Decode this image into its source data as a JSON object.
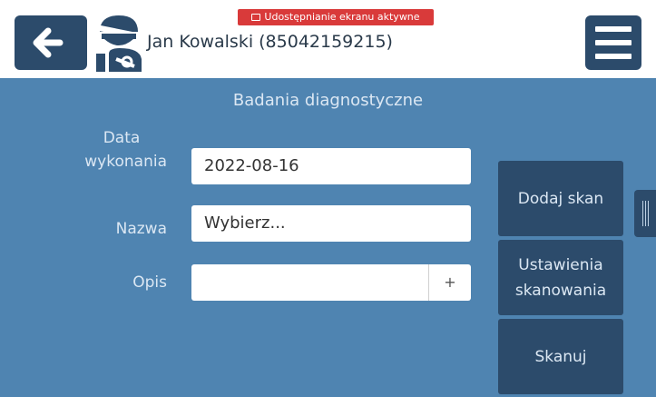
{
  "header": {
    "patient_name": "Jan Kowalski (85042159215)",
    "share_banner": "Udostępnianie ekranu aktywne",
    "back_icon": "arrow-left-icon",
    "menu_icon": "hamburger-menu-icon",
    "patient_icon": "injured-patient-icon"
  },
  "form": {
    "title": "Badania diagnostyczne",
    "date_label_line1": "Data",
    "date_label_line2": "wykonania",
    "date_value": "2022-08-16",
    "name_label": "Nazwa",
    "name_placeholder": "Wybierz...",
    "description_label": "Opis",
    "description_value": "",
    "add_symbol": "+"
  },
  "actions": {
    "add_scan": "Dodaj skan",
    "scan_settings_line1": "Ustawienia",
    "scan_settings_line2": "skanowania",
    "scan": "Skanuj"
  },
  "colors": {
    "panel_bg": "#4f84b1",
    "button_bg": "#2c4b6b",
    "banner_red": "#d93a3a"
  }
}
